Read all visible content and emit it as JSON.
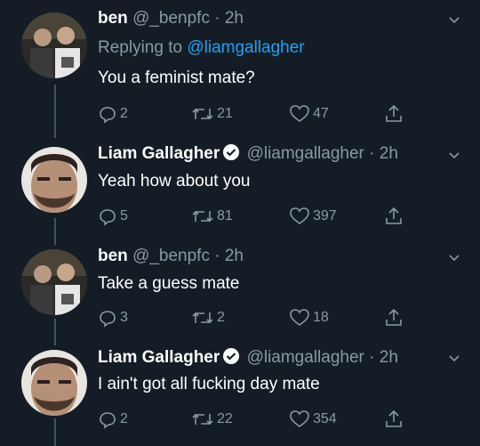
{
  "tweets": [
    {
      "name": "ben",
      "handle": "@_benpfc",
      "separator": "·",
      "time": "2h",
      "verified": false,
      "replying_prefix": "Replying to ",
      "replying_mention": "@liamgallagher",
      "text": "You a feminist mate?",
      "replies": "2",
      "retweets": "21",
      "likes": "47"
    },
    {
      "name": "Liam Gallagher",
      "handle": "@liamgallagher",
      "separator": "·",
      "time": "2h",
      "verified": true,
      "text": "Yeah how about you",
      "replies": "5",
      "retweets": "81",
      "likes": "397"
    },
    {
      "name": "ben",
      "handle": "@_benpfc",
      "separator": "·",
      "time": "2h",
      "verified": false,
      "text": "Take a guess mate",
      "replies": "3",
      "retweets": "2",
      "likes": "18"
    },
    {
      "name": "Liam Gallagher",
      "handle": "@liamgallagher",
      "separator": "·",
      "time": "2h",
      "verified": true,
      "text": "I ain't got all fucking day mate",
      "replies": "2",
      "retweets": "22",
      "likes": "354"
    }
  ],
  "icons": {
    "reply": "reply-icon",
    "retweet": "retweet-icon",
    "like": "heart-icon",
    "share": "share-icon",
    "more": "chevron-down-icon",
    "verified": "verified-badge-icon"
  },
  "colors": {
    "background": "#141d26",
    "secondary_text": "#8899a6",
    "link": "#1da1f2",
    "thread_line": "#3d5466"
  }
}
